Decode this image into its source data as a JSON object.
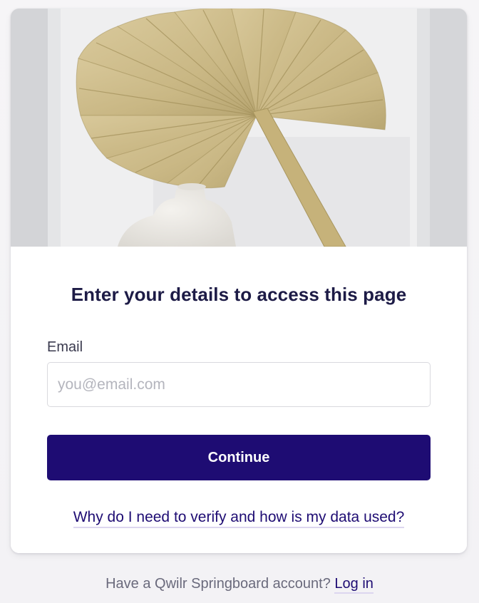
{
  "hero": {
    "image_name": "dried-palm-leaf-photo"
  },
  "form": {
    "title": "Enter your details to access this page",
    "email_label": "Email",
    "email_placeholder": "you@email.com",
    "email_value": "",
    "continue_label": "Continue",
    "verify_link": "Why do I need to verify and how is my data used?"
  },
  "footer": {
    "prompt": "Have a Qwilr Springboard account?",
    "login_label": "Log in"
  },
  "colors": {
    "primary": "#1e0c73",
    "title": "#1d1b46",
    "link_underline": "#dcd6ef"
  }
}
